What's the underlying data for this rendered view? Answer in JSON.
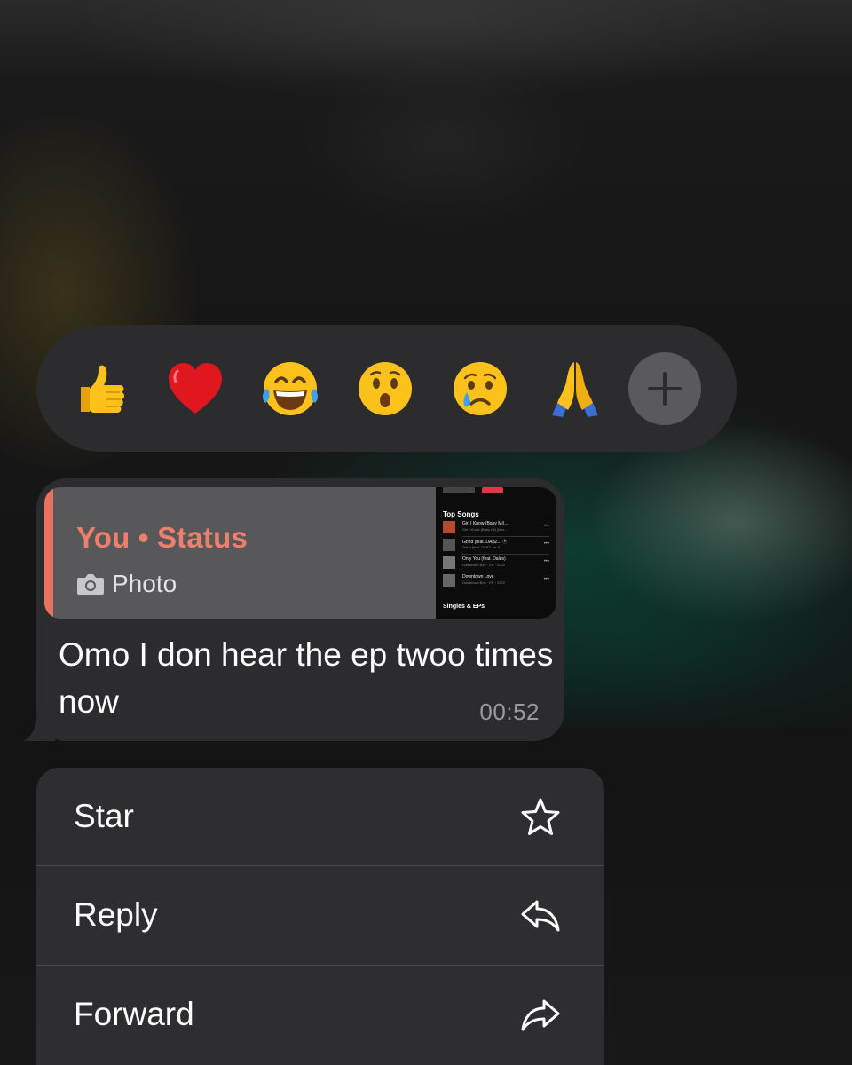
{
  "reaction_bar": {
    "emojis": [
      {
        "icon": "thumbs-up-emoji",
        "char": "👍"
      },
      {
        "icon": "red-heart-emoji",
        "char": "❤️"
      },
      {
        "icon": "tears-of-joy-emoji",
        "char": "😂"
      },
      {
        "icon": "surprised-face-emoji",
        "char": "😮"
      },
      {
        "icon": "crying-face-emoji",
        "char": "😢"
      },
      {
        "icon": "folded-hands-emoji",
        "char": "🙏"
      }
    ],
    "more_icon": "plus-icon"
  },
  "message": {
    "quote": {
      "author": "You • Status",
      "type_label": "Photo",
      "type_icon": "camera-icon",
      "thumbnail": {
        "heading": "Top Songs",
        "songs": [
          {
            "title": "Girl I Know (Baby Mi)...",
            "sub": "Girl I Know (Baby Mi) (fam..."
          },
          {
            "title": "Grind (feat. DABZ... ⓔ",
            "sub": "Grind (feat. DABZ Jor &..."
          },
          {
            "title": "Only You (feat. Dales)",
            "sub": "Downtown Boy · EP · 2022"
          },
          {
            "title": "Downtown Love",
            "sub": "Downtown Boy · EP · 2022"
          }
        ],
        "section": "Singles & EPs"
      },
      "accent_color": "#e8715f"
    },
    "text": "Omo I don hear the ep twoo times now",
    "time": "00:52"
  },
  "context_menu": {
    "items": [
      {
        "label": "Star",
        "icon": "star-icon"
      },
      {
        "label": "Reply",
        "icon": "reply-icon"
      },
      {
        "label": "Forward",
        "icon": "forward-icon"
      }
    ]
  }
}
